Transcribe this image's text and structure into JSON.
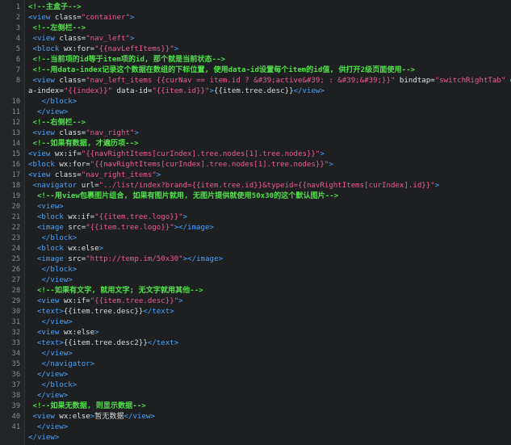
{
  "editor": {
    "lines": [
      {
        "num": "1",
        "tokens": [
          {
            "t": "cmt",
            "v": "<!--主盒子-->"
          }
        ]
      },
      {
        "num": "2",
        "tokens": [
          {
            "t": "tag",
            "v": "<view "
          },
          {
            "t": "attr",
            "v": "class="
          },
          {
            "t": "str",
            "v": "\"container\""
          },
          {
            "t": "tag",
            "v": ">"
          }
        ]
      },
      {
        "num": "3",
        "tokens": [
          {
            "t": "txt",
            "v": " "
          },
          {
            "t": "cmt",
            "v": "<!--左侧栏-->"
          }
        ]
      },
      {
        "num": "4",
        "tokens": [
          {
            "t": "txt",
            "v": " "
          },
          {
            "t": "tag",
            "v": "<view "
          },
          {
            "t": "attr",
            "v": "class="
          },
          {
            "t": "str",
            "v": "\"nav_left\""
          },
          {
            "t": "tag",
            "v": ">"
          }
        ]
      },
      {
        "num": "5",
        "tokens": [
          {
            "t": "txt",
            "v": " "
          },
          {
            "t": "tag",
            "v": "<block "
          },
          {
            "t": "attr",
            "v": "wx:for="
          },
          {
            "t": "str",
            "v": "\"{{navLeftItems}}\""
          },
          {
            "t": "tag",
            "v": ">"
          }
        ]
      },
      {
        "num": "6",
        "tokens": [
          {
            "t": "txt",
            "v": " "
          },
          {
            "t": "cmt",
            "v": "<!--当前项的id等于item项的id, 那个就是当前状态-->"
          }
        ]
      },
      {
        "num": "7",
        "tokens": [
          {
            "t": "txt",
            "v": " "
          },
          {
            "t": "cmt",
            "v": "<!--用data-index记录这个数据在数组的下标位置, 使用data-id设置每个item的id值, 供打开2级页面使用-->"
          }
        ]
      },
      {
        "num": "8",
        "tokens": [
          {
            "t": "txt",
            "v": " "
          },
          {
            "t": "tag",
            "v": "<view "
          },
          {
            "t": "attr",
            "v": "class="
          },
          {
            "t": "str",
            "v": "\"nav_left_items {{curNav == item.id ? &#39;active&#39; : &#39;&#39;}}\""
          },
          {
            "t": "attr",
            "v": " bindtap="
          },
          {
            "t": "str",
            "v": "\"switchRightTab\""
          },
          {
            "t": "attr",
            "v": " dat"
          }
        ]
      },
      {
        "num": "",
        "tokens": [
          {
            "t": "attr",
            "v": "a-index="
          },
          {
            "t": "str",
            "v": "\"{{index}}\""
          },
          {
            "t": "attr",
            "v": " data-id="
          },
          {
            "t": "str",
            "v": "\"{{item.id}}\""
          },
          {
            "t": "tag",
            "v": ">"
          },
          {
            "t": "txt",
            "v": "{{item.tree.desc}}"
          },
          {
            "t": "tag",
            "v": "</view>"
          }
        ]
      },
      {
        "num": "10",
        "tokens": [
          {
            "t": "txt",
            "v": "   "
          },
          {
            "t": "tag",
            "v": "</block>"
          }
        ]
      },
      {
        "num": "11",
        "tokens": [
          {
            "t": "txt",
            "v": "  "
          },
          {
            "t": "tag",
            "v": "</view>"
          }
        ]
      },
      {
        "num": "12",
        "tokens": [
          {
            "t": "txt",
            "v": " "
          },
          {
            "t": "cmt",
            "v": "<!--右侧栏-->"
          }
        ]
      },
      {
        "num": "13",
        "tokens": [
          {
            "t": "txt",
            "v": " "
          },
          {
            "t": "tag",
            "v": "<view "
          },
          {
            "t": "attr",
            "v": "class="
          },
          {
            "t": "str",
            "v": "\"nav_right\""
          },
          {
            "t": "tag",
            "v": ">"
          }
        ]
      },
      {
        "num": "14",
        "tokens": [
          {
            "t": "txt",
            "v": " "
          },
          {
            "t": "cmt",
            "v": "<!--如果有数据, 才遍历项-->"
          }
        ]
      },
      {
        "num": "15",
        "tokens": [
          {
            "t": "tag",
            "v": "<view "
          },
          {
            "t": "attr",
            "v": "wx:if="
          },
          {
            "t": "str",
            "v": "\"{{navRightItems[curIndex].tree.nodes[1].tree.nodes}}\""
          },
          {
            "t": "tag",
            "v": ">"
          }
        ]
      },
      {
        "num": "16",
        "tokens": [
          {
            "t": "tag",
            "v": "<block "
          },
          {
            "t": "attr",
            "v": "wx:for="
          },
          {
            "t": "str",
            "v": "\"{{navRightItems[curIndex].tree.nodes[1].tree.nodes}}\""
          },
          {
            "t": "tag",
            "v": ">"
          }
        ]
      },
      {
        "num": "17",
        "tokens": [
          {
            "t": "tag",
            "v": "<view "
          },
          {
            "t": "attr",
            "v": "class="
          },
          {
            "t": "str",
            "v": "\"nav_right_items\""
          },
          {
            "t": "tag",
            "v": ">"
          }
        ]
      },
      {
        "num": "18",
        "tokens": [
          {
            "t": "txt",
            "v": " "
          },
          {
            "t": "tag",
            "v": "<navigator "
          },
          {
            "t": "attr",
            "v": "url="
          },
          {
            "t": "str",
            "v": "\"../list/index?brand={{item.tree.id}}&typeid={{navRightItems[curIndex].id}}\""
          },
          {
            "t": "tag",
            "v": ">"
          }
        ]
      },
      {
        "num": "19",
        "tokens": [
          {
            "t": "txt",
            "v": "  "
          },
          {
            "t": "cmt",
            "v": "<!--用view包裹图片组合, 如果有图片就用, 无图片提供就使用50x30的这个默认图片-->"
          }
        ]
      },
      {
        "num": "20",
        "tokens": [
          {
            "t": "txt",
            "v": "  "
          },
          {
            "t": "tag",
            "v": "<view>"
          }
        ]
      },
      {
        "num": "21",
        "tokens": [
          {
            "t": "txt",
            "v": "  "
          },
          {
            "t": "tag",
            "v": "<block "
          },
          {
            "t": "attr",
            "v": "wx:if="
          },
          {
            "t": "str",
            "v": "\"{{item.tree.logo}}\""
          },
          {
            "t": "tag",
            "v": ">"
          }
        ]
      },
      {
        "num": "22",
        "tokens": [
          {
            "t": "txt",
            "v": "  "
          },
          {
            "t": "tag",
            "v": "<image "
          },
          {
            "t": "attr",
            "v": "src="
          },
          {
            "t": "str",
            "v": "\"{{item.tree.logo}}\""
          },
          {
            "t": "tag",
            "v": "></image>"
          }
        ]
      },
      {
        "num": "23",
        "tokens": [
          {
            "t": "txt",
            "v": "   "
          },
          {
            "t": "tag",
            "v": "</block>"
          }
        ]
      },
      {
        "num": "24",
        "tokens": [
          {
            "t": "txt",
            "v": "  "
          },
          {
            "t": "tag",
            "v": "<block "
          },
          {
            "t": "attr",
            "v": "wx:else"
          },
          {
            "t": "tag",
            "v": ">"
          }
        ]
      },
      {
        "num": "25",
        "tokens": [
          {
            "t": "txt",
            "v": "  "
          },
          {
            "t": "tag",
            "v": "<image "
          },
          {
            "t": "attr",
            "v": "src="
          },
          {
            "t": "str",
            "v": "\"http://temp.im/50x30\""
          },
          {
            "t": "tag",
            "v": "></image>"
          }
        ]
      },
      {
        "num": "26",
        "tokens": [
          {
            "t": "txt",
            "v": "   "
          },
          {
            "t": "tag",
            "v": "</block>"
          }
        ]
      },
      {
        "num": "27",
        "tokens": [
          {
            "t": "txt",
            "v": "   "
          },
          {
            "t": "tag",
            "v": "</view>"
          }
        ]
      },
      {
        "num": "28",
        "tokens": [
          {
            "t": "txt",
            "v": "  "
          },
          {
            "t": "cmt",
            "v": "<!--如果有文字, 就用文字; 无文字就用其他-->"
          }
        ]
      },
      {
        "num": "29",
        "tokens": [
          {
            "t": "txt",
            "v": "  "
          },
          {
            "t": "tag",
            "v": "<view "
          },
          {
            "t": "attr",
            "v": "wx:if="
          },
          {
            "t": "str",
            "v": "\"{{item.tree.desc}}\""
          },
          {
            "t": "tag",
            "v": ">"
          }
        ]
      },
      {
        "num": "30",
        "tokens": [
          {
            "t": "txt",
            "v": "  "
          },
          {
            "t": "tag",
            "v": "<text>"
          },
          {
            "t": "txt",
            "v": "{{item.tree.desc}}"
          },
          {
            "t": "tag",
            "v": "</text>"
          }
        ]
      },
      {
        "num": "31",
        "tokens": [
          {
            "t": "txt",
            "v": "   "
          },
          {
            "t": "tag",
            "v": "</view>"
          }
        ]
      },
      {
        "num": "32",
        "tokens": [
          {
            "t": "txt",
            "v": "  "
          },
          {
            "t": "tag",
            "v": "<view "
          },
          {
            "t": "attr",
            "v": "wx:else"
          },
          {
            "t": "tag",
            "v": ">"
          }
        ]
      },
      {
        "num": "33",
        "tokens": [
          {
            "t": "txt",
            "v": "  "
          },
          {
            "t": "tag",
            "v": "<text>"
          },
          {
            "t": "txt",
            "v": "{{item.tree.desc2}}"
          },
          {
            "t": "tag",
            "v": "</text>"
          }
        ]
      },
      {
        "num": "34",
        "tokens": [
          {
            "t": "txt",
            "v": "   "
          },
          {
            "t": "tag",
            "v": "</view>"
          }
        ]
      },
      {
        "num": "35",
        "tokens": [
          {
            "t": "txt",
            "v": "   "
          },
          {
            "t": "tag",
            "v": "</navigator>"
          }
        ]
      },
      {
        "num": "36",
        "tokens": [
          {
            "t": "txt",
            "v": "  "
          },
          {
            "t": "tag",
            "v": "</view>"
          }
        ]
      },
      {
        "num": "37",
        "tokens": [
          {
            "t": "txt",
            "v": "   "
          },
          {
            "t": "tag",
            "v": "</block>"
          }
        ]
      },
      {
        "num": "38",
        "tokens": [
          {
            "t": "txt",
            "v": "  "
          },
          {
            "t": "tag",
            "v": "</view>"
          }
        ]
      },
      {
        "num": "39",
        "tokens": [
          {
            "t": "txt",
            "v": " "
          },
          {
            "t": "cmt",
            "v": "<!--如果无数据, 则显示数据-->"
          }
        ]
      },
      {
        "num": "40",
        "tokens": [
          {
            "t": "txt",
            "v": " "
          },
          {
            "t": "tag",
            "v": "<view "
          },
          {
            "t": "attr",
            "v": "wx:else"
          },
          {
            "t": "tag",
            "v": ">"
          },
          {
            "t": "txt",
            "v": "暂无数据"
          },
          {
            "t": "tag",
            "v": "</view>"
          }
        ]
      },
      {
        "num": "41",
        "tokens": [
          {
            "t": "txt",
            "v": "  "
          },
          {
            "t": "tag",
            "v": "</view>"
          }
        ]
      },
      {
        "num": "",
        "tokens": [
          {
            "t": "tag",
            "v": "</view>"
          }
        ]
      }
    ]
  }
}
